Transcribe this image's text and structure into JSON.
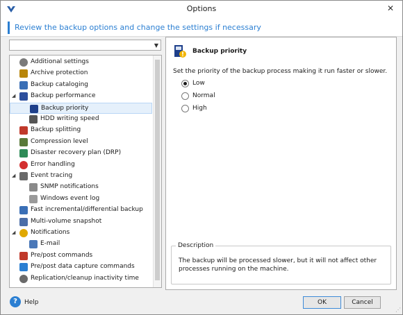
{
  "window": {
    "title": "Options"
  },
  "header": {
    "text": "Review the backup options and change the settings if necessary"
  },
  "filter": {
    "value": ""
  },
  "tree": [
    {
      "label": "Additional settings",
      "icon": "gear-icon",
      "level": 0,
      "expander": "",
      "selected": false
    },
    {
      "label": "Archive protection",
      "icon": "lock-icon",
      "level": 0,
      "expander": "",
      "selected": false
    },
    {
      "label": "Backup cataloging",
      "icon": "catalog-icon",
      "level": 0,
      "expander": "",
      "selected": false
    },
    {
      "label": "Backup performance",
      "icon": "performance-icon",
      "level": 0,
      "expander": "◢",
      "selected": false
    },
    {
      "label": "Backup priority",
      "icon": "priority-icon",
      "level": 1,
      "expander": "",
      "selected": true
    },
    {
      "label": "HDD writing speed",
      "icon": "hdd-icon",
      "level": 1,
      "expander": "",
      "selected": false
    },
    {
      "label": "Backup splitting",
      "icon": "split-icon",
      "level": 0,
      "expander": "",
      "selected": false
    },
    {
      "label": "Compression level",
      "icon": "compression-icon",
      "level": 0,
      "expander": "",
      "selected": false
    },
    {
      "label": "Disaster recovery plan (DRP)",
      "icon": "drp-icon",
      "level": 0,
      "expander": "",
      "selected": false
    },
    {
      "label": "Error handling",
      "icon": "error-icon",
      "level": 0,
      "expander": "",
      "selected": false
    },
    {
      "label": "Event tracing",
      "icon": "magnifier-icon",
      "level": 0,
      "expander": "◢",
      "selected": false
    },
    {
      "label": "SNMP notifications",
      "icon": "snmp-icon",
      "level": 1,
      "expander": "",
      "selected": false
    },
    {
      "label": "Windows event log",
      "icon": "event-log-icon",
      "level": 1,
      "expander": "",
      "selected": false
    },
    {
      "label": "Fast incremental/differential backup",
      "icon": "fast-backup-icon",
      "level": 0,
      "expander": "",
      "selected": false
    },
    {
      "label": "Multi-volume snapshot",
      "icon": "snapshot-icon",
      "level": 0,
      "expander": "",
      "selected": false
    },
    {
      "label": "Notifications",
      "icon": "notification-icon",
      "level": 0,
      "expander": "◢",
      "selected": false
    },
    {
      "label": "E-mail",
      "icon": "email-icon",
      "level": 1,
      "expander": "",
      "selected": false
    },
    {
      "label": "Pre/post commands",
      "icon": "commands-icon",
      "level": 0,
      "expander": "",
      "selected": false
    },
    {
      "label": "Pre/post data capture commands",
      "icon": "data-capture-icon",
      "level": 0,
      "expander": "",
      "selected": false
    },
    {
      "label": "Replication/cleanup inactivity time",
      "icon": "clock-icon",
      "level": 0,
      "expander": "",
      "selected": false
    }
  ],
  "panel": {
    "title": "Backup priority",
    "description": "Set the priority of the backup process making it run faster or slower.",
    "options": [
      {
        "label": "Low",
        "checked": true
      },
      {
        "label": "Normal",
        "checked": false
      },
      {
        "label": "High",
        "checked": false
      }
    ],
    "desc_legend": "Description",
    "desc_text": "The backup will be processed slower, but it will not affect other processes running on the machine."
  },
  "footer": {
    "help": "Help",
    "ok": "OK",
    "cancel": "Cancel"
  },
  "colors": {
    "accent": "#2b7fd2",
    "selected_bg": "#e5f0fb"
  }
}
